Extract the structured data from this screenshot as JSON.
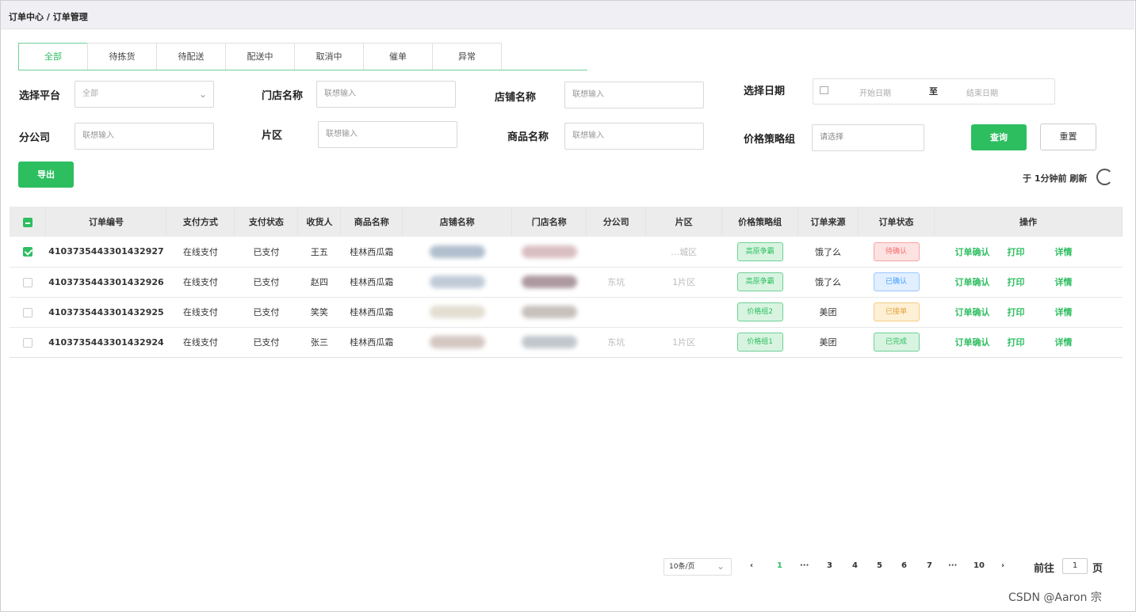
{
  "breadcrumb": {
    "level1": "订单中心",
    "sep": "/",
    "level2": "订单管理"
  },
  "tabs": [
    "全部",
    "待拣货",
    "待配送",
    "配送中",
    "取消中",
    "催单",
    "异常"
  ],
  "filters": {
    "platform_label": "选择平台",
    "platform_value": "全部",
    "store_label": "门店名称",
    "store_placeholder": "联想输入",
    "shop_label": "店铺名称",
    "shop_placeholder": "联想输入",
    "date_label": "选择日期",
    "date_start": "开始日期",
    "date_sep": "至",
    "date_end": "结束日期",
    "branch_label": "分公司",
    "branch_placeholder": "联想输入",
    "area_label": "片区",
    "area_placeholder": "联想输入",
    "product_label": "商品名称",
    "product_placeholder": "联想输入",
    "price_group_label": "价格策略组",
    "price_group_placeholder": "请选择",
    "query_button": "查询",
    "reset_button": "重置"
  },
  "export_button": "导出",
  "refresh_text": "于 1分钟前 刷新",
  "table": {
    "headers": [
      "订单编号",
      "支付方式",
      "支付状态",
      "收货人",
      "商品名称",
      "店铺名称",
      "门店名称",
      "分公司",
      "片区",
      "价格策略组",
      "订单来源",
      "订单状态",
      "操作"
    ],
    "rows": [
      {
        "checked": true,
        "order_no": "4103735443301432927",
        "pay_method": "在线支付",
        "pay_status": "已支付",
        "receiver": "王五",
        "product": "桂林西瓜霜",
        "price_group": "高原争霸",
        "source": "饿了么",
        "status": "待确认",
        "status_color": "red",
        "area": "…城区",
        "branch": ""
      },
      {
        "checked": false,
        "order_no": "4103735443301432926",
        "pay_method": "在线支付",
        "pay_status": "已支付",
        "receiver": "赵四",
        "product": "桂林西瓜霜",
        "price_group": "高原争霸",
        "source": "饿了么",
        "status": "已确认",
        "status_color": "blue",
        "area": "1片区",
        "branch": "东坑"
      },
      {
        "checked": false,
        "order_no": "4103735443301432925",
        "pay_method": "在线支付",
        "pay_status": "已支付",
        "receiver": "笑笑",
        "product": "桂林西瓜霜",
        "price_group": "价格组2",
        "source": "美团",
        "status": "已接单",
        "status_color": "orange",
        "area": "",
        "branch": ""
      },
      {
        "checked": false,
        "order_no": "4103735443301432924",
        "pay_method": "在线支付",
        "pay_status": "已支付",
        "receiver": "张三",
        "product": "桂林西瓜霜",
        "price_group": "价格组1",
        "source": "美团",
        "status": "已完成",
        "status_color": "green",
        "area": "1片区",
        "branch": "东坑"
      }
    ],
    "actions": {
      "confirm": "订单确认",
      "print": "打印",
      "detail": "详情"
    }
  },
  "pagination": {
    "page_size": "10条/页",
    "pages": [
      "1",
      "···",
      "3",
      "4",
      "5",
      "6",
      "7",
      "···",
      "10"
    ],
    "active_page": "1",
    "goto_label": "前往",
    "goto_value": "1",
    "goto_suffix": "页"
  },
  "watermark": "CSDN @Aaron 宗",
  "colors": {
    "accent": "#2dbe60"
  }
}
